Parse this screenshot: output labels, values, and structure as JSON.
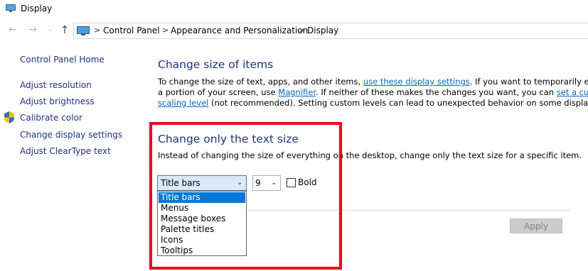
{
  "window": {
    "title": "Display"
  },
  "address_bar": {
    "crumbs": [
      "Control Panel",
      "Appearance and Personalization",
      "Display"
    ]
  },
  "sidebar": {
    "items": [
      {
        "label": "Control Panel Home"
      },
      {
        "label": "Adjust resolution"
      },
      {
        "label": "Adjust brightness"
      },
      {
        "label": "Calibrate color"
      },
      {
        "label": "Change display settings"
      },
      {
        "label": "Adjust ClearType text"
      }
    ]
  },
  "main": {
    "heading": "Change size of items",
    "paragraph": {
      "l1_a": "To change the size of text, apps, and other items, ",
      "l1_link": "use these display settings",
      "l1_b": ".  If you want to temporarily enlarge",
      "l2_a": "a portion of your screen, use ",
      "l2_link": "Magnifier",
      "l2_b": ".  If neither of these makes the changes you want, you can ",
      "l2_link2": "set a custom",
      "l3_link": "scaling level",
      "l3_b": " (not recommended).  Setting custom levels can lead to unexpected behavior on some displays."
    }
  },
  "text_size": {
    "heading": "Change only the text size",
    "description": "Instead of changing the size of everything on the desktop, change only the text size for a specific item.",
    "item_select": {
      "value": "Title bars",
      "options": [
        "Title bars",
        "Menus",
        "Message boxes",
        "Palette titles",
        "Icons",
        "Tooltips"
      ]
    },
    "size_select": {
      "value": "9"
    },
    "bold_label": "Bold",
    "apply_label": "Apply"
  },
  "colors": {
    "highlight_box": "#ea0a1a",
    "link": "#0066cc",
    "heading": "#1e3287",
    "selected_option": "#0078d7"
  },
  "icons": {
    "title": "display-app-icon",
    "address": "monitor-icon",
    "shield": "uac-shield-icon",
    "nav": [
      "back-arrow-icon",
      "forward-arrow-icon",
      "recent-chevron-icon",
      "up-arrow-icon"
    ]
  }
}
